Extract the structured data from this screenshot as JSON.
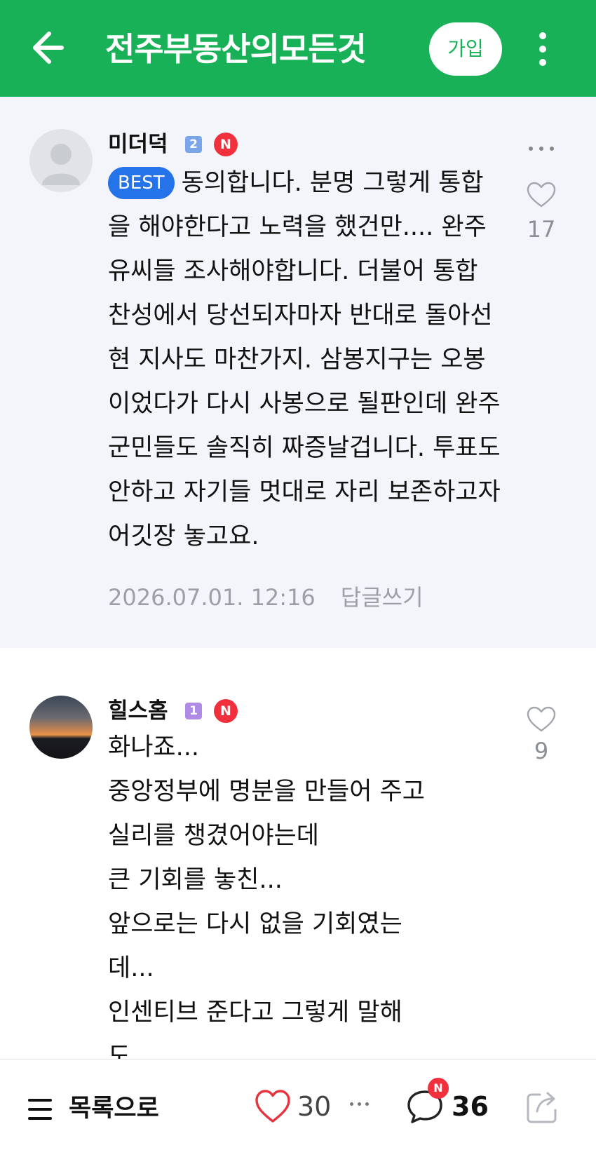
{
  "header": {
    "title": "전주부동산의모든것",
    "join_label": "가입",
    "brand_color": "#19b158",
    "icons": [
      "arrow-left-icon",
      "more-vertical-icon"
    ]
  },
  "comments": [
    {
      "nickname": "미더덕",
      "level": "2",
      "new_badge": "N",
      "best_label": "BEST",
      "text": "동의합니다. 분명 그렇게 통합을 해야한다고 노력을 했건만.... 완주 유씨들 조사해야합니다. 더불어 통합 찬성에서 당선되자마자 반대로 돌아선 현 지사도 마찬가지. 삼봉지구는 오봉이었다가 다시 사봉으로 될판인데 완주군민들도 솔직히 짜증날겁니다. 투표도 안하고 자기들 멋대로 자리 보존하고자 어깃장 놓고요.",
      "date": "2026.07.01. 12:16",
      "reply_label": "답글쓰기",
      "likes": "17"
    },
    {
      "nickname": "힐스홈",
      "level": "1",
      "new_badge": "N",
      "lines": [
        "화나죠...",
        "중앙정부에 명분을 만들어 주고",
        "실리를 챙겼어야는데",
        "큰 기회를 놓친...",
        "앞으로는 다시 없을 기회였는",
        "데...",
        "인센티브 준다고 그렇게 말해",
        "도..."
      ],
      "likes": "9"
    }
  ],
  "bottom_bar": {
    "list_label": "목록으로",
    "like_count": "30",
    "comment_new_badge": "N",
    "comment_count": "36"
  }
}
